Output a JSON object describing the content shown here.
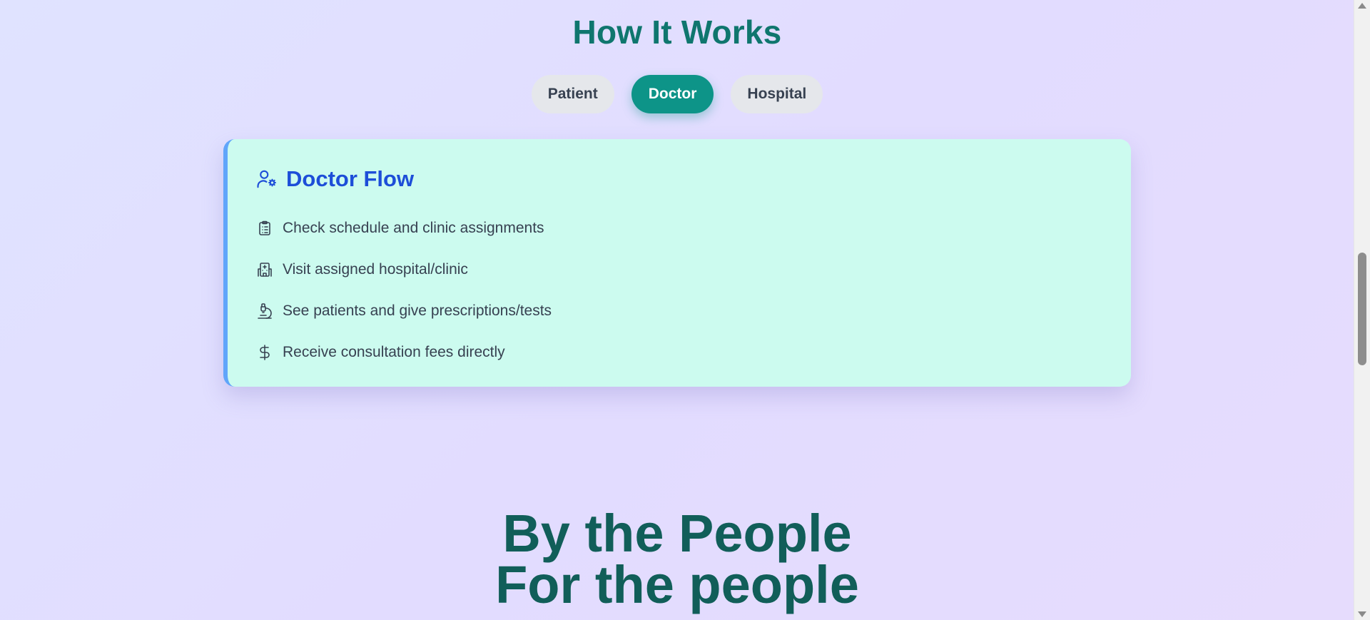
{
  "how_it_works": {
    "title": "How It Works",
    "tabs": [
      {
        "label": "Patient",
        "active": false
      },
      {
        "label": "Doctor",
        "active": true
      },
      {
        "label": "Hospital",
        "active": false
      }
    ]
  },
  "flow_card": {
    "icon": "user-gear-icon",
    "title": "Doctor Flow",
    "items": [
      {
        "icon": "clipboard-list-icon",
        "text": "Check schedule and clinic assignments"
      },
      {
        "icon": "hospital-building-icon",
        "text": "Visit assigned hospital/clinic"
      },
      {
        "icon": "microscope-icon",
        "text": "See patients and give prescriptions/tests"
      },
      {
        "icon": "dollar-sign-icon",
        "text": "Receive consultation fees directly"
      }
    ]
  },
  "tagline": {
    "line1": "By the People",
    "line2": "For the people"
  },
  "colors": {
    "accent": "#0d9488",
    "title": "#0f766e",
    "flow_title": "#1d4ed8",
    "card_bg": "#ccfbef",
    "card_border": "#60a5fa"
  }
}
